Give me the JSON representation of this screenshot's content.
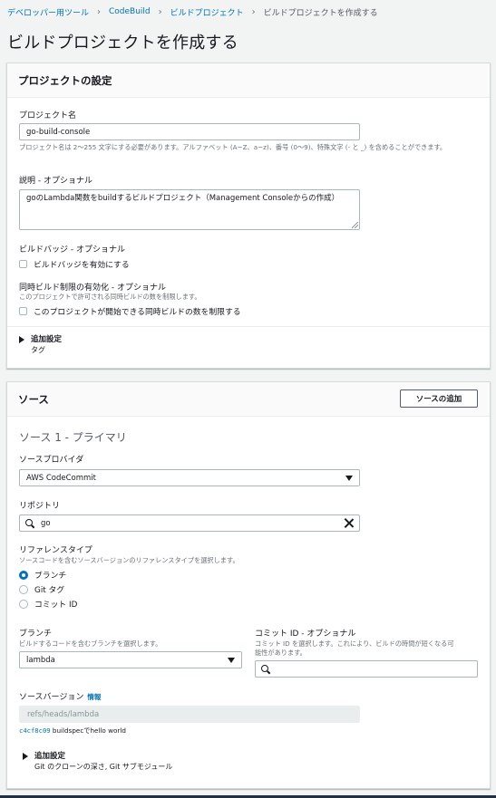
{
  "breadcrumb": {
    "items": [
      "デベロッパー用ツール",
      "CodeBuild",
      "ビルドプロジェクト"
    ],
    "current": "ビルドプロジェクトを作成する"
  },
  "page_title": "ビルドプロジェクトを作成する",
  "project_settings": {
    "title": "プロジェクトの設定",
    "name_label": "プロジェクト名",
    "name_value": "go-build-console",
    "name_hint": "プロジェクト名は 2～255 文字にする必要があります。アルファベット (A~Z、a~z)、番号 (0～9)、特殊文字 (- と _) を含めることができます。",
    "description_label": "説明 - オプショナル",
    "description_value": "goのLambda関数をbuildするビルドプロジェクト（Management Consoleからの作成）",
    "badge_label": "ビルドバッジ - オプショナル",
    "badge_checkbox": "ビルドバッジを有効にする",
    "concurrency_label": "同時ビルド制限の有効化 - オプショナル",
    "concurrency_hint": "このプロジェクトで許可される同時ビルドの数を制限します。",
    "concurrency_checkbox": "このプロジェクトが開始できる同時ビルドの数を制限する",
    "additional_title": "追加設定",
    "additional_sub": "タグ"
  },
  "source": {
    "title": "ソース",
    "add_button": "ソースの追加",
    "subtitle": "ソース 1 - プライマリ",
    "provider_label": "ソースプロバイダ",
    "provider_value": "AWS CodeCommit",
    "repo_label": "リポジトリ",
    "repo_value": "go",
    "ref_type_label": "リファレンスタイプ",
    "ref_type_hint": "ソースコードを含むソースバージョンのリファレンスタイプを選択します。",
    "ref_options": [
      "ブランチ",
      "Git タグ",
      "コミット ID"
    ],
    "branch_label": "ブランチ",
    "branch_hint": "ビルドするコードを含むブランチを選択します。",
    "branch_value": "lambda",
    "commit_label": "コミット ID - オプショナル",
    "commit_hint_1": "コミット ID を選択します。これにより、ビルドの時間が短くなる可",
    "commit_hint_2": "能性があります。",
    "commit_value": "",
    "version_label": "ソースバージョン",
    "version_info": "情報",
    "version_value": "refs/heads/lambda",
    "commit_hash": "c4cf8c09",
    "commit_message": "buildspecでhello world",
    "additional_title": "追加設定",
    "additional_sub": "Git のクローンの深さ, Git サブモジュール"
  }
}
